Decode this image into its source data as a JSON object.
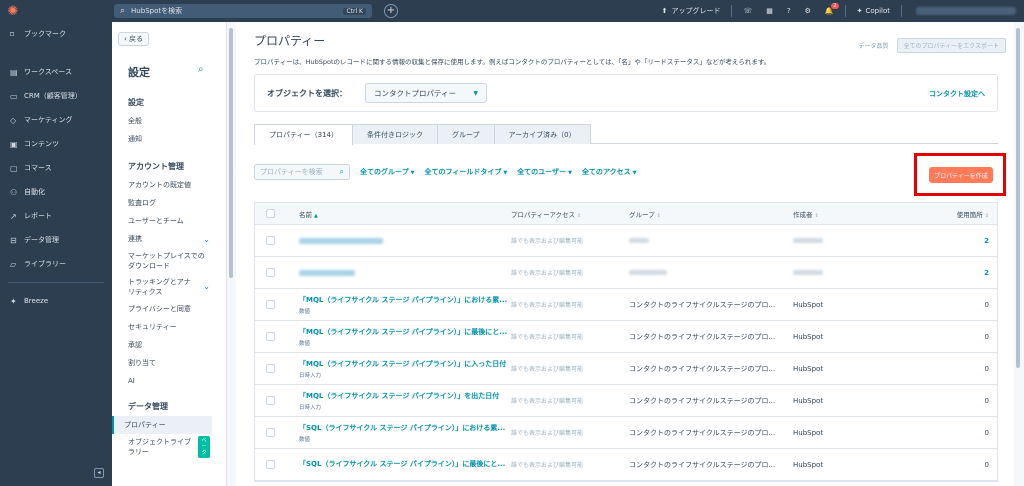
{
  "topbar": {
    "search_placeholder": "HubSpotを検索",
    "shortcut": "Ctrl K",
    "upgrade_label": "アップグレード",
    "notification_count": "2",
    "copilot_label": "Copilot"
  },
  "leftnav": {
    "items": [
      {
        "label": "ブックマーク",
        "icon": "bookmark-icon"
      },
      {
        "label": "ワークスペース",
        "icon": "workspace-icon"
      },
      {
        "label": "CRM（顧客管理）",
        "icon": "crm-icon"
      },
      {
        "label": "マーケティング",
        "icon": "marketing-icon"
      },
      {
        "label": "コンテンツ",
        "icon": "content-icon"
      },
      {
        "label": "コマース",
        "icon": "commerce-icon"
      },
      {
        "label": "自動化",
        "icon": "automation-icon"
      },
      {
        "label": "レポート",
        "icon": "report-icon"
      },
      {
        "label": "データ管理",
        "icon": "data-icon"
      },
      {
        "label": "ライブラリー",
        "icon": "library-icon"
      }
    ],
    "breeze_label": "Breeze"
  },
  "settings": {
    "back_label": "戻る",
    "title": "設定",
    "sections": {
      "settings_head": "設定",
      "general": "全般",
      "notifications": "通知",
      "account_head": "アカウント管理",
      "account_defaults": "アカウントの既定値",
      "audit_log": "監査ログ",
      "users_teams": "ユーザーとチーム",
      "integrations": "連携",
      "marketplace_1": "マーケットプレイスでの",
      "marketplace_2": "ダウンロード",
      "tracking_1": "トラッキングとアナ",
      "tracking_2": "リティクス",
      "privacy": "プライバシーと同意",
      "security": "セキュリティー",
      "approvals": "承認",
      "assignment": "割り当て",
      "ai": "AI",
      "data_head": "データ管理",
      "properties": "プロパティー",
      "objects_1": "オブジェクトライブ",
      "objects_2": "ラリー",
      "beta": "ベータ"
    }
  },
  "main": {
    "title": "プロパティー",
    "data_quality": "データ品質",
    "export_label": "全てのプロパティーをエクスポート",
    "description": "プロパティーは、HubSpotのレコードに関する情報の収集と保存に使用します。例えばコンタクトのプロパティーとしては、「名」や「リードステータス」などが考えられます。",
    "object_label": "オブジェクトを選択：",
    "object_value": "コンタクトプロパティー",
    "contact_settings": "コンタクト設定へ",
    "tabs": [
      "プロパティー（314）",
      "条件付きロジック",
      "グループ",
      "アーカイブ済み（0）"
    ],
    "search_placeholder": "プロパティーを検索",
    "filters": [
      "全てのグループ",
      "全てのフィールドタイプ",
      "全てのユーザー",
      "全てのアクセス"
    ],
    "create_label": "プロパティーを作成",
    "columns": {
      "name": "名前",
      "access": "プロパティーアクセス",
      "group": "グループ",
      "creator": "作成者",
      "usage": "使用箇所"
    },
    "rows": [
      {
        "name": "",
        "type": "",
        "access": "誰でも表示および編集可能",
        "group": "",
        "creator": "",
        "usage": "2"
      },
      {
        "name": "",
        "type": "",
        "access": "誰でも表示および編集可能",
        "group": "",
        "creator": "",
        "usage": "2"
      },
      {
        "name": "「MQL（ライフサイクル ステージ パイプライン）」における累...",
        "type": "数値",
        "access": "誰でも表示および編集可能",
        "group": "コンタクトのライフサイクルステージのプロ...",
        "creator": "HubSpot",
        "usage": "0"
      },
      {
        "name": "「MQL（ライフサイクル ステージ パイプライン）」に最後にと...",
        "type": "数値",
        "access": "誰でも表示および編集可能",
        "group": "コンタクトのライフサイクルステージのプロ...",
        "creator": "HubSpot",
        "usage": "0"
      },
      {
        "name": "「MQL（ライフサイクル ステージ パイプライン）」に入った日付",
        "type": "日時入力",
        "access": "誰でも表示および編集可能",
        "group": "コンタクトのライフサイクルステージのプロ...",
        "creator": "HubSpot",
        "usage": "0"
      },
      {
        "name": "「MQL（ライフサイクル ステージ パイプライン）」を出た日付",
        "type": "日時入力",
        "access": "誰でも表示および編集可能",
        "group": "コンタクトのライフサイクルステージのプロ...",
        "creator": "HubSpot",
        "usage": "0"
      },
      {
        "name": "「SQL（ライフサイクル ステージ パイプライン）」における累...",
        "type": "数値",
        "access": "誰でも表示および編集可能",
        "group": "コンタクトのライフサイクルステージのプロ...",
        "creator": "HubSpot",
        "usage": "0"
      },
      {
        "name": "「SQL（ライフサイクル ステージ パイプライン）」に最後にと...",
        "type": "",
        "access": "誰でも表示および編集可能",
        "group": "コンタクトのライフサイクルステージのプロ...",
        "creator": "HubSpot",
        "usage": "0"
      }
    ]
  },
  "colors": {
    "accent": "#0091ae",
    "brand": "#ff7a59",
    "highlight_frame": "#e30000",
    "nav_bg": "#2d3e50"
  }
}
